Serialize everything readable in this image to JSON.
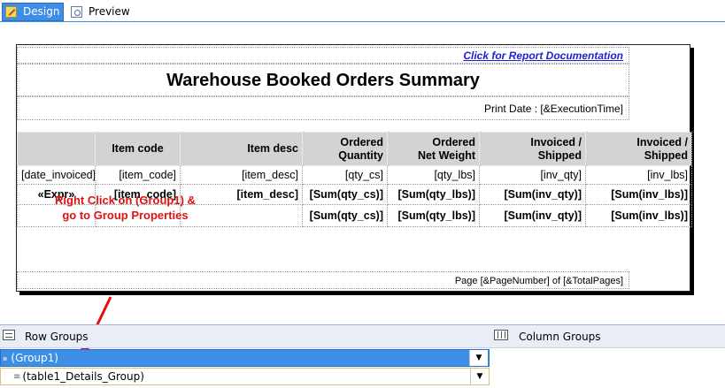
{
  "tabs": {
    "design": "Design",
    "preview": "Preview"
  },
  "report": {
    "doc_link": "Click for Report Documentation",
    "title": "Warehouse Booked Orders Summary",
    "print_date": "Print Date  : [&ExecutionTime]",
    "page_footer": "Page [&PageNumber]  of [&TotalPages]",
    "table": {
      "headers": [
        "",
        "Item code",
        "Item desc",
        "Ordered\nQuantity",
        "Ordered\nNet Weight",
        "Invoiced /\nShipped",
        "Invoiced /\nShipped"
      ],
      "rows": [
        [
          "[date_invoiced]",
          "[item_code]",
          "[item_desc]",
          "[qty_cs]",
          "[qty_lbs]",
          "[inv_qty]",
          "[inv_lbs]"
        ],
        [
          "«Expr»",
          "[item_code]",
          "[item_desc]",
          "[Sum(qty_cs)]",
          "[Sum(qty_lbs)]",
          "[Sum(inv_qty)]",
          "[Sum(inv_lbs)]"
        ],
        [
          "",
          "",
          "",
          "[Sum(qty_cs)]",
          "[Sum(qty_lbs)]",
          "[Sum(inv_qty)]",
          "[Sum(inv_lbs)]"
        ]
      ]
    }
  },
  "annotation": {
    "line1": "Right Click on (Group1) &",
    "line2": "go to Group Properties",
    "color": "#e01212"
  },
  "grouping": {
    "row_groups_label": "Row Groups",
    "column_groups_label": "Column Groups",
    "items": [
      {
        "label": "(Group1)",
        "selected": true
      },
      {
        "label": "(table1_Details_Group)",
        "selected": false
      }
    ]
  },
  "colors": {
    "accent": "#3d8ee6",
    "header_bg": "#d3d3d3",
    "link": "#1f1fd6"
  },
  "icons": {
    "design_tab": "design-icon",
    "preview_tab": "preview-icon",
    "row_groups": "row-groups-icon",
    "column_groups": "column-groups-icon",
    "dropdown": "chevron-down-icon"
  }
}
